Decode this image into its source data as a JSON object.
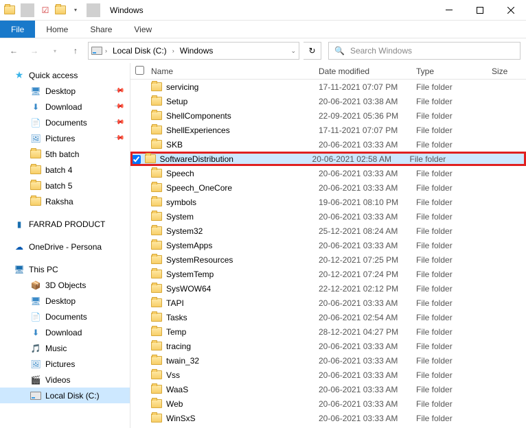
{
  "window": {
    "title": "Windows"
  },
  "ribbon": {
    "file": "File",
    "tabs": [
      "Home",
      "Share",
      "View"
    ]
  },
  "breadcrumb": [
    "Local Disk (C:)",
    "Windows"
  ],
  "search": {
    "placeholder": "Search Windows"
  },
  "nav": {
    "quick_access": {
      "label": "Quick access",
      "items": [
        {
          "label": "Desktop",
          "pinned": true,
          "icon": "desktop"
        },
        {
          "label": "Download",
          "pinned": true,
          "icon": "download"
        },
        {
          "label": "Documents",
          "pinned": true,
          "icon": "documents"
        },
        {
          "label": "Pictures",
          "pinned": true,
          "icon": "pictures"
        },
        {
          "label": "5th batch",
          "pinned": false,
          "icon": "folder"
        },
        {
          "label": "batch 4",
          "pinned": false,
          "icon": "folder"
        },
        {
          "label": "batch 5",
          "pinned": false,
          "icon": "folder"
        },
        {
          "label": "Raksha",
          "pinned": false,
          "icon": "folder"
        }
      ]
    },
    "farrad": {
      "label": "FARRAD PRODUCT"
    },
    "onedrive": {
      "label": "OneDrive - Persona"
    },
    "this_pc": {
      "label": "This PC",
      "items": [
        {
          "label": "3D Objects",
          "icon": "3d"
        },
        {
          "label": "Desktop",
          "icon": "desktop"
        },
        {
          "label": "Documents",
          "icon": "documents"
        },
        {
          "label": "Download",
          "icon": "download"
        },
        {
          "label": "Music",
          "icon": "music"
        },
        {
          "label": "Pictures",
          "icon": "pictures"
        },
        {
          "label": "Videos",
          "icon": "videos"
        },
        {
          "label": "Local Disk (C:)",
          "icon": "drive",
          "selected": true
        }
      ]
    }
  },
  "columns": {
    "name": "Name",
    "date": "Date modified",
    "type": "Type",
    "size": "Size"
  },
  "type_label": "File folder",
  "files": [
    {
      "name": "servicing",
      "date": "17-11-2021 07:07 PM"
    },
    {
      "name": "Setup",
      "date": "20-06-2021 03:38 AM"
    },
    {
      "name": "ShellComponents",
      "date": "22-09-2021 05:36 PM"
    },
    {
      "name": "ShellExperiences",
      "date": "17-11-2021 07:07 PM"
    },
    {
      "name": "SKB",
      "date": "20-06-2021 03:33 AM"
    },
    {
      "name": "SoftwareDistribution",
      "date": "20-06-2021 02:58 AM",
      "highlighted": true,
      "checked": true
    },
    {
      "name": "Speech",
      "date": "20-06-2021 03:33 AM"
    },
    {
      "name": "Speech_OneCore",
      "date": "20-06-2021 03:33 AM"
    },
    {
      "name": "symbols",
      "date": "19-06-2021 08:10 PM"
    },
    {
      "name": "System",
      "date": "20-06-2021 03:33 AM"
    },
    {
      "name": "System32",
      "date": "25-12-2021 08:24 AM"
    },
    {
      "name": "SystemApps",
      "date": "20-06-2021 03:33 AM"
    },
    {
      "name": "SystemResources",
      "date": "20-12-2021 07:25 PM"
    },
    {
      "name": "SystemTemp",
      "date": "20-12-2021 07:24 PM"
    },
    {
      "name": "SysWOW64",
      "date": "22-12-2021 02:12 PM"
    },
    {
      "name": "TAPI",
      "date": "20-06-2021 03:33 AM"
    },
    {
      "name": "Tasks",
      "date": "20-06-2021 02:54 AM"
    },
    {
      "name": "Temp",
      "date": "28-12-2021 04:27 PM"
    },
    {
      "name": "tracing",
      "date": "20-06-2021 03:33 AM"
    },
    {
      "name": "twain_32",
      "date": "20-06-2021 03:33 AM"
    },
    {
      "name": "Vss",
      "date": "20-06-2021 03:33 AM"
    },
    {
      "name": "WaaS",
      "date": "20-06-2021 03:33 AM"
    },
    {
      "name": "Web",
      "date": "20-06-2021 03:33 AM"
    },
    {
      "name": "WinSxS",
      "date": "20-06-2021 03:33 AM"
    }
  ]
}
